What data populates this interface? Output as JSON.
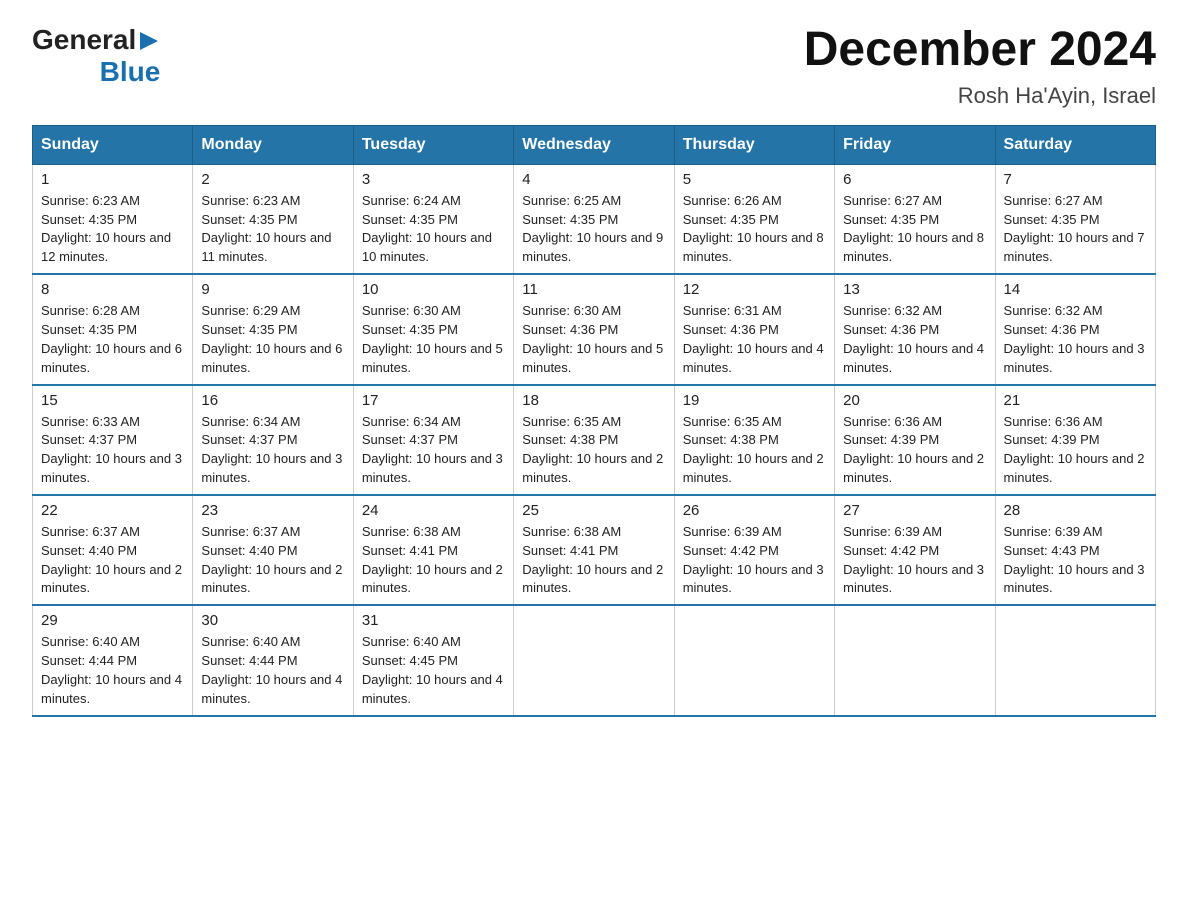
{
  "logo": {
    "text_general": "General",
    "triangle": "▶",
    "text_blue": "Blue"
  },
  "title": "December 2024",
  "subtitle": "Rosh Ha'Ayin, Israel",
  "days_of_week": [
    "Sunday",
    "Monday",
    "Tuesday",
    "Wednesday",
    "Thursday",
    "Friday",
    "Saturday"
  ],
  "weeks": [
    [
      {
        "day": "1",
        "sunrise": "6:23 AM",
        "sunset": "4:35 PM",
        "daylight": "10 hours and 12 minutes."
      },
      {
        "day": "2",
        "sunrise": "6:23 AM",
        "sunset": "4:35 PM",
        "daylight": "10 hours and 11 minutes."
      },
      {
        "day": "3",
        "sunrise": "6:24 AM",
        "sunset": "4:35 PM",
        "daylight": "10 hours and 10 minutes."
      },
      {
        "day": "4",
        "sunrise": "6:25 AM",
        "sunset": "4:35 PM",
        "daylight": "10 hours and 9 minutes."
      },
      {
        "day": "5",
        "sunrise": "6:26 AM",
        "sunset": "4:35 PM",
        "daylight": "10 hours and 8 minutes."
      },
      {
        "day": "6",
        "sunrise": "6:27 AM",
        "sunset": "4:35 PM",
        "daylight": "10 hours and 8 minutes."
      },
      {
        "day": "7",
        "sunrise": "6:27 AM",
        "sunset": "4:35 PM",
        "daylight": "10 hours and 7 minutes."
      }
    ],
    [
      {
        "day": "8",
        "sunrise": "6:28 AM",
        "sunset": "4:35 PM",
        "daylight": "10 hours and 6 minutes."
      },
      {
        "day": "9",
        "sunrise": "6:29 AM",
        "sunset": "4:35 PM",
        "daylight": "10 hours and 6 minutes."
      },
      {
        "day": "10",
        "sunrise": "6:30 AM",
        "sunset": "4:35 PM",
        "daylight": "10 hours and 5 minutes."
      },
      {
        "day": "11",
        "sunrise": "6:30 AM",
        "sunset": "4:36 PM",
        "daylight": "10 hours and 5 minutes."
      },
      {
        "day": "12",
        "sunrise": "6:31 AM",
        "sunset": "4:36 PM",
        "daylight": "10 hours and 4 minutes."
      },
      {
        "day": "13",
        "sunrise": "6:32 AM",
        "sunset": "4:36 PM",
        "daylight": "10 hours and 4 minutes."
      },
      {
        "day": "14",
        "sunrise": "6:32 AM",
        "sunset": "4:36 PM",
        "daylight": "10 hours and 3 minutes."
      }
    ],
    [
      {
        "day": "15",
        "sunrise": "6:33 AM",
        "sunset": "4:37 PM",
        "daylight": "10 hours and 3 minutes."
      },
      {
        "day": "16",
        "sunrise": "6:34 AM",
        "sunset": "4:37 PM",
        "daylight": "10 hours and 3 minutes."
      },
      {
        "day": "17",
        "sunrise": "6:34 AM",
        "sunset": "4:37 PM",
        "daylight": "10 hours and 3 minutes."
      },
      {
        "day": "18",
        "sunrise": "6:35 AM",
        "sunset": "4:38 PM",
        "daylight": "10 hours and 2 minutes."
      },
      {
        "day": "19",
        "sunrise": "6:35 AM",
        "sunset": "4:38 PM",
        "daylight": "10 hours and 2 minutes."
      },
      {
        "day": "20",
        "sunrise": "6:36 AM",
        "sunset": "4:39 PM",
        "daylight": "10 hours and 2 minutes."
      },
      {
        "day": "21",
        "sunrise": "6:36 AM",
        "sunset": "4:39 PM",
        "daylight": "10 hours and 2 minutes."
      }
    ],
    [
      {
        "day": "22",
        "sunrise": "6:37 AM",
        "sunset": "4:40 PM",
        "daylight": "10 hours and 2 minutes."
      },
      {
        "day": "23",
        "sunrise": "6:37 AM",
        "sunset": "4:40 PM",
        "daylight": "10 hours and 2 minutes."
      },
      {
        "day": "24",
        "sunrise": "6:38 AM",
        "sunset": "4:41 PM",
        "daylight": "10 hours and 2 minutes."
      },
      {
        "day": "25",
        "sunrise": "6:38 AM",
        "sunset": "4:41 PM",
        "daylight": "10 hours and 2 minutes."
      },
      {
        "day": "26",
        "sunrise": "6:39 AM",
        "sunset": "4:42 PM",
        "daylight": "10 hours and 3 minutes."
      },
      {
        "day": "27",
        "sunrise": "6:39 AM",
        "sunset": "4:42 PM",
        "daylight": "10 hours and 3 minutes."
      },
      {
        "day": "28",
        "sunrise": "6:39 AM",
        "sunset": "4:43 PM",
        "daylight": "10 hours and 3 minutes."
      }
    ],
    [
      {
        "day": "29",
        "sunrise": "6:40 AM",
        "sunset": "4:44 PM",
        "daylight": "10 hours and 4 minutes."
      },
      {
        "day": "30",
        "sunrise": "6:40 AM",
        "sunset": "4:44 PM",
        "daylight": "10 hours and 4 minutes."
      },
      {
        "day": "31",
        "sunrise": "6:40 AM",
        "sunset": "4:45 PM",
        "daylight": "10 hours and 4 minutes."
      },
      null,
      null,
      null,
      null
    ]
  ]
}
